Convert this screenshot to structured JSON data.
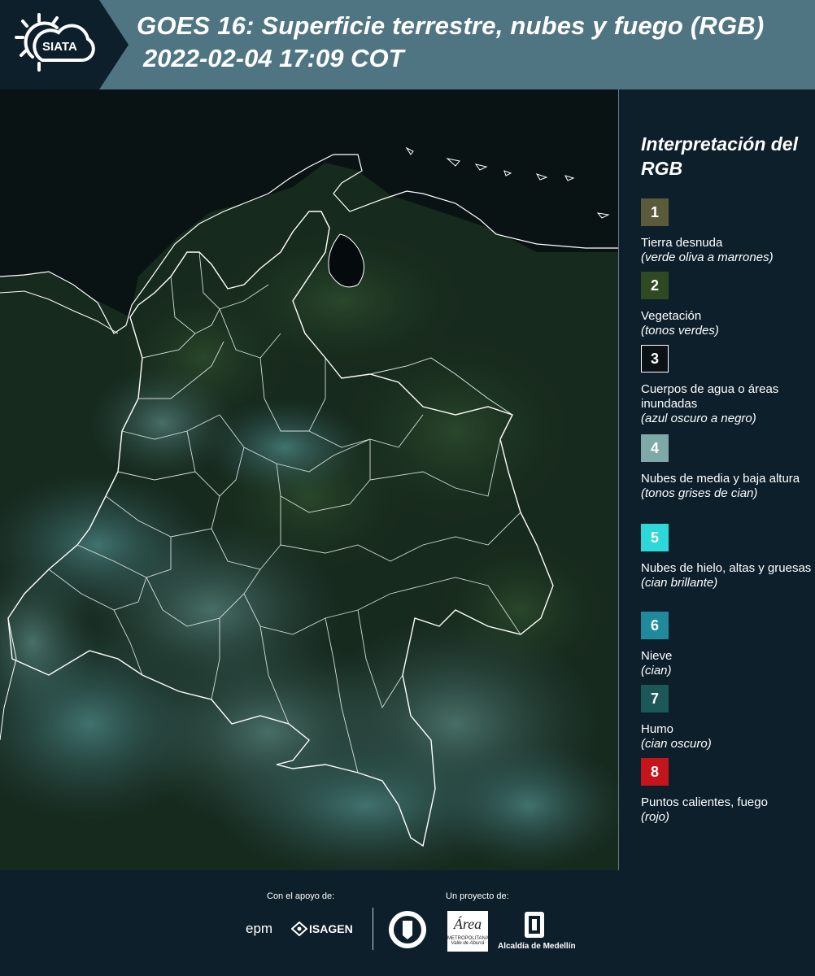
{
  "header": {
    "title_line1": "GOES 16: Superficie terrestre, nubes y fuego (RGB)",
    "title_line2": "2022-02-04 17:09 COT",
    "logo_text": "SIATA"
  },
  "legend": {
    "title": "Interpretación del RGB",
    "items": [
      {
        "number": "1",
        "label": "Tierra desnuda",
        "sub": "(verde oliva a marrones)",
        "color": "#5b5b3c"
      },
      {
        "number": "2",
        "label": "Vegetación",
        "sub": "(tonos verdes)",
        "color": "#2f4a22"
      },
      {
        "number": "3",
        "label": "Cuerpos de agua o áreas inundadas",
        "sub": "(azul oscuro a negro)",
        "color": "#0b1216"
      },
      {
        "number": "4",
        "label": "Nubes de media y baja altura",
        "sub": "(tonos grises de cian)",
        "color": "#7fa8a8"
      },
      {
        "number": "5",
        "label": "Nubes de hielo, altas y gruesas",
        "sub": "(cian brillante)",
        "color": "#2ed8d8"
      },
      {
        "number": "6",
        "label": "Nieve",
        "sub": "(cian)",
        "color": "#1e8a9c"
      },
      {
        "number": "7",
        "label": "Humo",
        "sub": "(cian oscuro)",
        "color": "#1d5858"
      },
      {
        "number": "8",
        "label": "Puntos calientes, fuego",
        "sub": "(rojo)",
        "color": "#c4151c"
      }
    ]
  },
  "footer": {
    "support_caption": "Con el apoyo de:",
    "project_caption": "Un proyecto de:",
    "sponsor_epm": "epm",
    "sponsor_isagen": "ISAGEN",
    "area_logo_text": "Área",
    "area_logo_sub": "METROPOLITANA",
    "area_logo_sub2": "Valle de Aburrá",
    "alcaldia_text": "Alcaldía de Medellín"
  }
}
